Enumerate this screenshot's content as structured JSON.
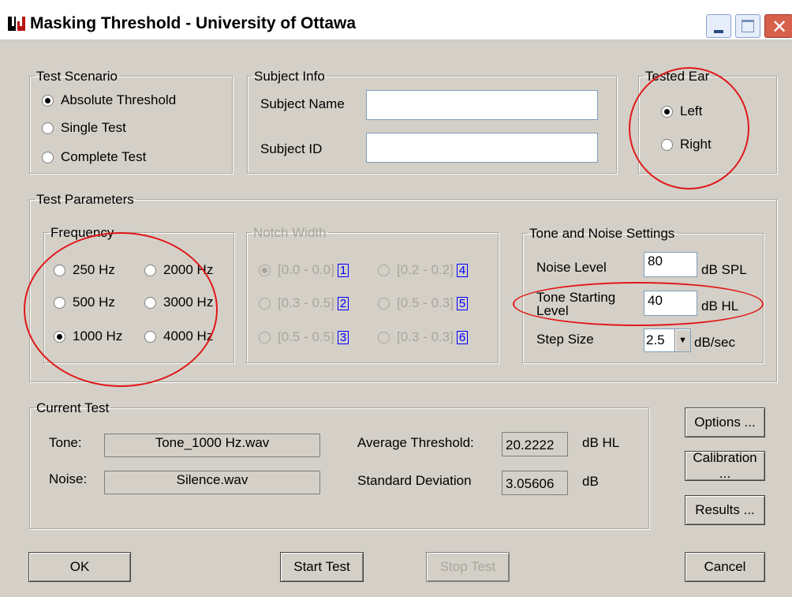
{
  "window": {
    "title": "Masking Threshold - University of Ottawa",
    "app_icon": "uottawa-logo-icon",
    "controls": [
      "minimize-icon",
      "maximize-icon",
      "close-icon"
    ]
  },
  "test_scenario": {
    "legend": "Test Scenario",
    "options": [
      "Absolute Threshold",
      "Single Test",
      "Complete Test"
    ],
    "selected": "Absolute Threshold"
  },
  "subject_info": {
    "legend": "Subject Info",
    "name_label": "Subject Name",
    "name_value": "",
    "id_label": "Subject ID",
    "id_value": ""
  },
  "tested_ear": {
    "legend": "Tested Ear",
    "options": [
      "Left",
      "Right"
    ],
    "selected": "Left"
  },
  "test_parameters": {
    "legend": "Test Parameters",
    "frequency": {
      "legend": "Frequency",
      "options": [
        "250 Hz",
        "2000 Hz",
        "500 Hz",
        "3000 Hz",
        "1000 Hz",
        "4000 Hz"
      ],
      "selected": "1000 Hz"
    },
    "notch_width": {
      "legend": "Notch Width",
      "enabled": false,
      "options": [
        {
          "label": "[0.0 - 0.0]",
          "num": "1"
        },
        {
          "label": "[0.2 - 0.2]",
          "num": "4"
        },
        {
          "label": "[0.3 - 0.5]",
          "num": "2"
        },
        {
          "label": "[0.5 - 0.3]",
          "num": "5"
        },
        {
          "label": "[0.5 - 0.5]",
          "num": "3"
        },
        {
          "label": "[0.3 - 0.3]",
          "num": "6"
        }
      ],
      "selected": "[0.0 - 0.0]"
    },
    "tone_noise": {
      "legend": "Tone and Noise Settings",
      "noise_level_label": "Noise Level",
      "noise_level_value": "80",
      "noise_level_unit": "dB SPL",
      "tone_start_label_1": "Tone Starting",
      "tone_start_label_2": "Level",
      "tone_start_value": "40",
      "tone_start_unit": "dB HL",
      "step_size_label": "Step Size",
      "step_size_value": "2.5",
      "step_size_unit": "dB/sec"
    }
  },
  "current_test": {
    "legend": "Current Test",
    "tone_label": "Tone:",
    "tone_value": "Tone_1000 Hz.wav",
    "noise_label": "Noise:",
    "noise_value": "Silence.wav",
    "avg_label": "Average Threshold:",
    "avg_value": "20.2222",
    "avg_unit": "dB HL",
    "std_label": "Standard Deviation",
    "std_value": "3.05606",
    "std_unit": "dB"
  },
  "side_buttons": {
    "options": "Options ...",
    "calibration": "Calibration ...",
    "results": "Results ..."
  },
  "bottom_buttons": {
    "ok": "OK",
    "start": "Start Test",
    "stop": "Stop Test",
    "cancel": "Cancel"
  },
  "annotation_color": "#e01818"
}
